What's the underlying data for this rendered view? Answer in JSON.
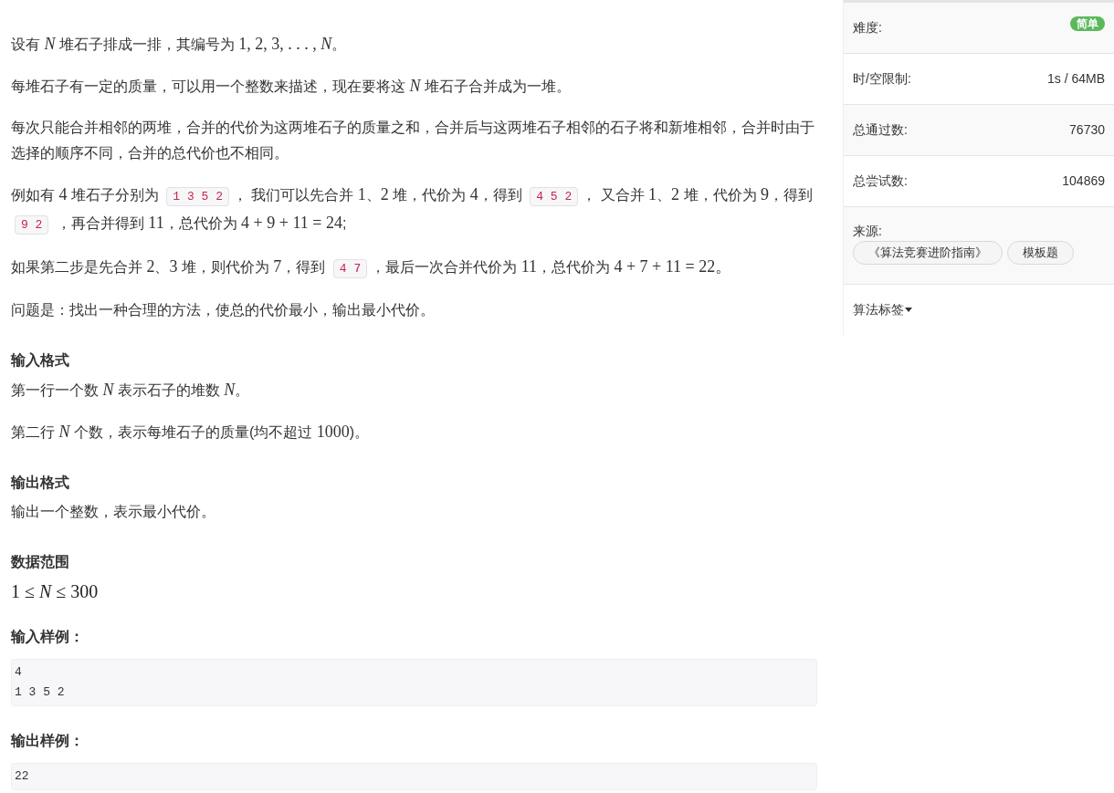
{
  "problem": {
    "blocks": [
      {
        "kind": "paragraph",
        "segments": [
          {
            "kind": "text",
            "text": "设有 "
          },
          {
            "kind": "math",
            "text": "*N*"
          },
          {
            "kind": "text",
            "text": " 堆石子排成一排，其编号为 "
          },
          {
            "kind": "math",
            "text": "1, 2, 3, . . . , *N*"
          },
          {
            "kind": "text",
            "text": "。"
          }
        ]
      },
      {
        "kind": "paragraph",
        "segments": [
          {
            "kind": "text",
            "text": "每堆石子有一定的质量，可以用一个整数来描述，现在要将这 "
          },
          {
            "kind": "math",
            "text": "*N*"
          },
          {
            "kind": "text",
            "text": " 堆石子合并成为一堆。"
          }
        ]
      },
      {
        "kind": "paragraph",
        "segments": [
          {
            "kind": "text",
            "text": "每次只能合并相邻的两堆，合并的代价为这两堆石子的质量之和，合并后与这两堆石子相邻的石子将和新堆相邻，合并时由于选择的顺序不同，合并的总代价也不相同。"
          }
        ]
      },
      {
        "kind": "paragraph",
        "segments": [
          {
            "kind": "text",
            "text": "例如有 "
          },
          {
            "kind": "math",
            "text": "4"
          },
          {
            "kind": "text",
            "text": " 堆石子分别为 "
          },
          {
            "kind": "code",
            "text": "1 3 5 2"
          },
          {
            "kind": "text",
            "text": "， 我们可以先合并 "
          },
          {
            "kind": "math",
            "text": "1"
          },
          {
            "kind": "text",
            "text": "、"
          },
          {
            "kind": "math",
            "text": "2"
          },
          {
            "kind": "text",
            "text": " 堆，代价为 "
          },
          {
            "kind": "math",
            "text": "4"
          },
          {
            "kind": "text",
            "text": "，得到 "
          },
          {
            "kind": "code",
            "text": "4 5 2"
          },
          {
            "kind": "text",
            "text": "， 又合并 "
          },
          {
            "kind": "math",
            "text": "1"
          },
          {
            "kind": "text",
            "text": "、"
          },
          {
            "kind": "math",
            "text": "2"
          },
          {
            "kind": "text",
            "text": " 堆，代价为 "
          },
          {
            "kind": "math",
            "text": "9"
          },
          {
            "kind": "text",
            "text": "，得到 "
          },
          {
            "kind": "code",
            "text": "9 2"
          },
          {
            "kind": "text",
            "text": " ，再合并得到 "
          },
          {
            "kind": "math",
            "text": "11"
          },
          {
            "kind": "text",
            "text": "，总代价为 "
          },
          {
            "kind": "math",
            "text": "4 + 9 + 11 = 24"
          },
          {
            "kind": "text",
            "text": ";"
          }
        ]
      },
      {
        "kind": "paragraph",
        "segments": [
          {
            "kind": "text",
            "text": "如果第二步是先合并 "
          },
          {
            "kind": "math",
            "text": "2"
          },
          {
            "kind": "text",
            "text": "、"
          },
          {
            "kind": "math",
            "text": "3"
          },
          {
            "kind": "text",
            "text": " 堆，则代价为 "
          },
          {
            "kind": "math",
            "text": "7"
          },
          {
            "kind": "text",
            "text": "，得到 "
          },
          {
            "kind": "code",
            "text": "4 7"
          },
          {
            "kind": "text",
            "text": "，最后一次合并代价为 "
          },
          {
            "kind": "math",
            "text": "11"
          },
          {
            "kind": "text",
            "text": "，总代价为 "
          },
          {
            "kind": "math",
            "text": "4 + 7 + 11 = 22。"
          }
        ]
      },
      {
        "kind": "paragraph",
        "segments": [
          {
            "kind": "text",
            "text": "问题是：找出一种合理的方法，使总的代价最小，输出最小代价。"
          }
        ]
      },
      {
        "kind": "heading",
        "text": "输入格式"
      },
      {
        "kind": "paragraph",
        "segments": [
          {
            "kind": "text",
            "text": "第一行一个数 "
          },
          {
            "kind": "math",
            "text": "*N*"
          },
          {
            "kind": "text",
            "text": " 表示石子的堆数 "
          },
          {
            "kind": "math",
            "text": "*N*"
          },
          {
            "kind": "text",
            "text": "。"
          }
        ]
      },
      {
        "kind": "paragraph",
        "segments": [
          {
            "kind": "text",
            "text": "第二行 "
          },
          {
            "kind": "math",
            "text": "*N*"
          },
          {
            "kind": "text",
            "text": " 个数，表示每堆石子的质量(均不超过 "
          },
          {
            "kind": "math",
            "text": "1000"
          },
          {
            "kind": "text",
            "text": ")。"
          }
        ]
      },
      {
        "kind": "heading",
        "text": "输出格式"
      },
      {
        "kind": "paragraph",
        "segments": [
          {
            "kind": "text",
            "text": "输出一个整数，表示最小代价。"
          }
        ]
      },
      {
        "kind": "heading",
        "text": "数据范围"
      },
      {
        "kind": "formula",
        "text": "1 ≤ *N* ≤ 300"
      },
      {
        "kind": "heading",
        "text": "输入样例："
      },
      {
        "kind": "sample",
        "lines": [
          "4",
          "1 3 5 2"
        ]
      },
      {
        "kind": "heading",
        "text": "输出样例："
      },
      {
        "kind": "sample",
        "lines": [
          "22"
        ]
      }
    ]
  },
  "sidebar": {
    "rows": [
      {
        "kind": "badge",
        "label": "难度:",
        "value": "简单"
      },
      {
        "kind": "value",
        "label": "时/空限制:",
        "value": "1s / 64MB"
      },
      {
        "kind": "value",
        "label": "总通过数:",
        "value": "76730"
      },
      {
        "kind": "value",
        "label": "总尝试数:",
        "value": "104869"
      },
      {
        "kind": "tags",
        "label": "来源:",
        "tags": [
          "《算法竞赛进阶指南》",
          "模板题"
        ]
      }
    ],
    "tags_toggle": {
      "label": "算法标签",
      "expanded": false
    }
  }
}
